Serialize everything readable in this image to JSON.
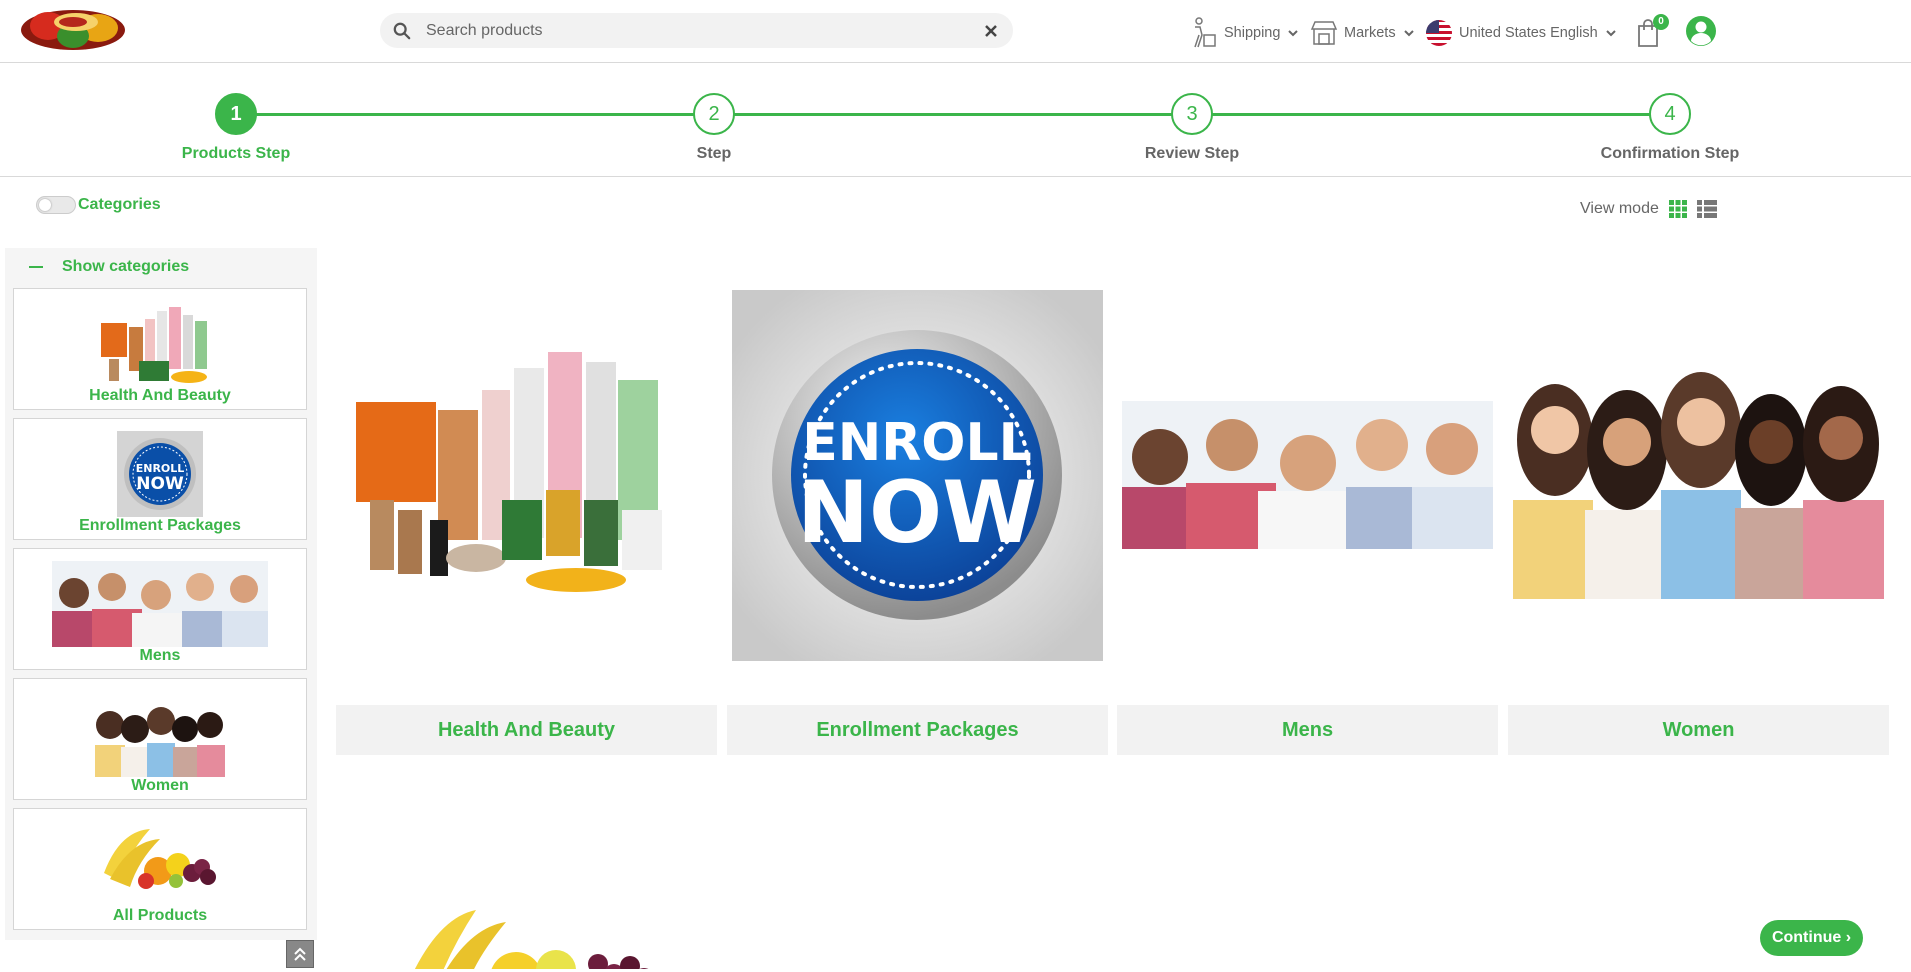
{
  "header": {
    "search_placeholder": "Search products",
    "shipping_label": "Shipping",
    "markets_label": "Markets",
    "language_label": "United States English",
    "cart_count": "0",
    "icons": [
      "search-icon",
      "clear-icon",
      "shipping-icon",
      "market-icon",
      "us-flag-icon",
      "cart-icon",
      "user-icon"
    ]
  },
  "steps": [
    {
      "number": "1",
      "label": "Products Step"
    },
    {
      "number": "2",
      "label": "Step"
    },
    {
      "number": "3",
      "label": "Review Step"
    },
    {
      "number": "4",
      "label": "Confirmation Step"
    }
  ],
  "toolbar": {
    "categories_toggle_label": "Categories",
    "view_mode_label": "View mode"
  },
  "sidebar": {
    "show_categories_label": "Show categories",
    "items": [
      {
        "label": "Health And Beauty"
      },
      {
        "label": "Enrollment Packages"
      },
      {
        "label": "Mens"
      },
      {
        "label": "Women"
      },
      {
        "label": "All Products"
      }
    ]
  },
  "main": {
    "cards": [
      {
        "title": "Health And Beauty"
      },
      {
        "title": "Enrollment Packages"
      },
      {
        "title": "Mens"
      },
      {
        "title": "Women"
      }
    ],
    "enroll_badge": {
      "line1": "ENROLL",
      "line2": "NOW"
    }
  },
  "footer": {
    "continue_label": "Continue"
  },
  "colors": {
    "accent": "#3bb54a",
    "panel": "#f5f5f5",
    "enroll_blue": "#0a4fa8"
  }
}
